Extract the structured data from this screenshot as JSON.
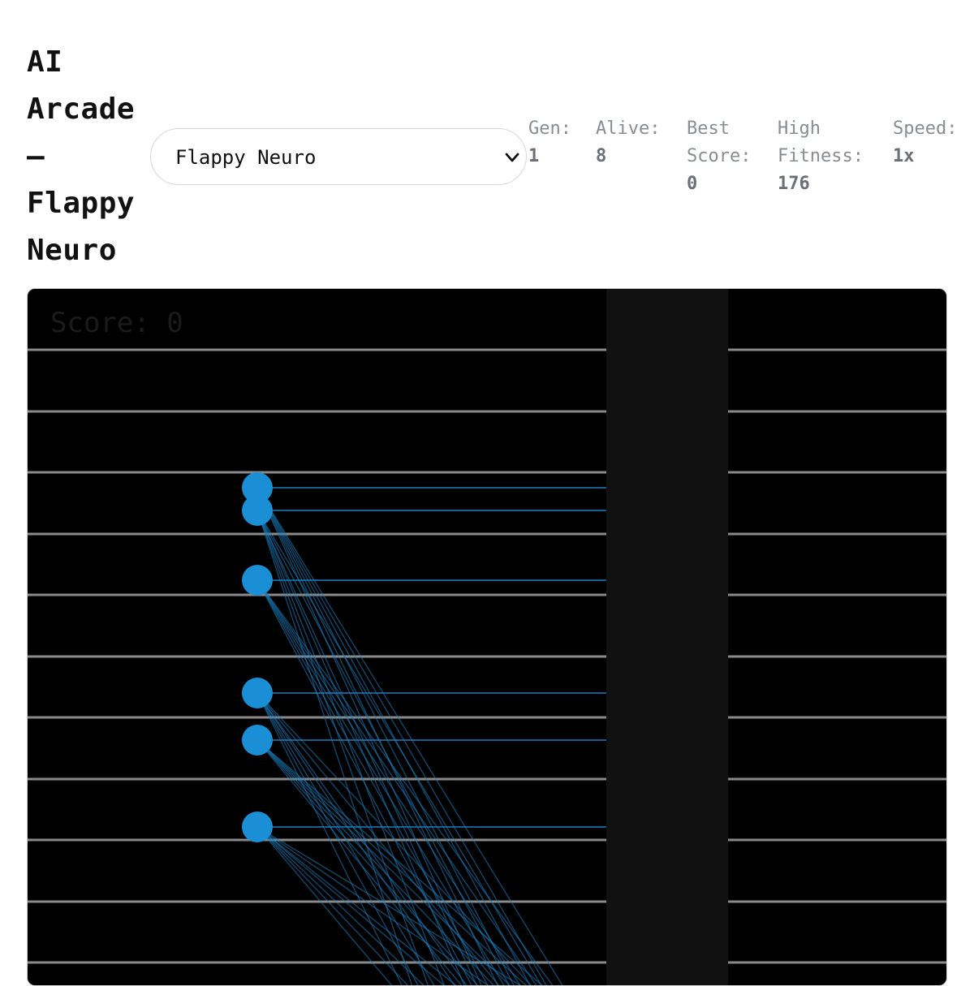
{
  "header": {
    "title_lines": [
      "AI",
      "Arcade",
      "—",
      "Flappy",
      "Neuro"
    ]
  },
  "game_select": {
    "selected": "Flappy Neuro"
  },
  "stats": {
    "gen": {
      "label": "Gen:",
      "value": "1"
    },
    "alive": {
      "label": "Alive:",
      "value": "8"
    },
    "best_score": {
      "label_1": "Best",
      "label_2": "Score:",
      "value": "0"
    },
    "high_fitness": {
      "label_1": "High",
      "label_2": "Fitness:",
      "value": "176"
    },
    "speed": {
      "label": "Speed:",
      "value": "1x"
    }
  },
  "game": {
    "score_text": "Score: 0",
    "background_color": "#000000",
    "pipe_color": "#111111",
    "grid_line_color": "#8a8a8a",
    "bird_color": "#1a8fd6",
    "sensor_color": "#1a7fbf"
  }
}
